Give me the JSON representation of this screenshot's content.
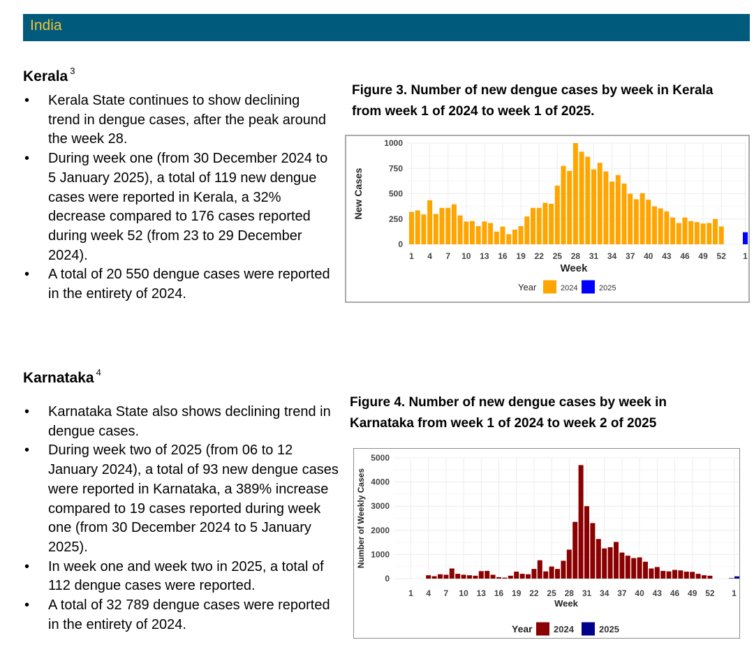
{
  "header": {
    "country": "India"
  },
  "colors": {
    "banner": "#005a7c",
    "banner_text": "#f5c338"
  },
  "kerala": {
    "title": "Kerala",
    "ref": "3",
    "bullets": [
      "Kerala State continues to show declining trend in dengue cases, after the peak around the week 28.",
      "During week one (from 30 December 2024 to 5 January 2025), a total of 119 new dengue cases were reported in Kerala, a 32% decrease compared to 176 cases reported during week 52 (from 23 to 29 December 2024).",
      "A total of 20 550 dengue cases were reported in the entirety of 2024."
    ],
    "figure_caption_line1": "Figure 3. Number of new dengue cases by week in Kerala",
    "figure_caption_line2": "from week 1 of 2024 to week 1 of 2025."
  },
  "karnataka": {
    "title": "Karnataka",
    "ref": "4",
    "bullets": [
      "Karnataka State also shows declining trend in dengue cases.",
      "During week two of 2025 (from 06 to 12 January 2024), a total of 93 new dengue cases were reported in Karnataka, a 389% increase compared to 19 cases reported during week one (from 30 December 2024 to 5 January 2025).",
      "In week one and week two in 2025, a total of 112 dengue cases were reported.",
      "A total of 32 789 dengue cases were reported in the entirety of 2024."
    ],
    "figure_caption_line1": "Figure 4. Number of new dengue cases by week in",
    "figure_caption_line2": "Karnataka from week 1 of 2024 to week 2 of 2025"
  },
  "chart_data": [
    {
      "type": "bar",
      "xlabel": "Week",
      "ylabel": "New Cases",
      "ylim": [
        0,
        1000
      ],
      "yticks": [
        0,
        250,
        500,
        750,
        1000
      ],
      "xtick_labels_2024": [
        "1",
        "4",
        "7",
        "10",
        "13",
        "16",
        "19",
        "22",
        "25",
        "28",
        "31",
        "34",
        "37",
        "40",
        "43",
        "46",
        "49",
        "52"
      ],
      "xtick_labels_2025": [
        "1"
      ],
      "legend_title": "Year",
      "legend_position": "bottom",
      "grid": true,
      "series": [
        {
          "name": "2024",
          "color": "#ffa500",
          "weeks": [
            1,
            2,
            3,
            4,
            5,
            6,
            7,
            8,
            9,
            10,
            11,
            12,
            13,
            14,
            15,
            16,
            17,
            18,
            19,
            20,
            21,
            22,
            23,
            24,
            25,
            26,
            27,
            28,
            29,
            30,
            31,
            32,
            33,
            34,
            35,
            36,
            37,
            38,
            39,
            40,
            41,
            42,
            43,
            44,
            45,
            46,
            47,
            48,
            49,
            50,
            51,
            52
          ],
          "values": [
            320,
            335,
            295,
            435,
            300,
            360,
            360,
            395,
            285,
            225,
            230,
            180,
            225,
            210,
            125,
            175,
            100,
            145,
            180,
            275,
            360,
            360,
            410,
            400,
            580,
            775,
            725,
            1000,
            915,
            865,
            740,
            805,
            720,
            620,
            685,
            600,
            500,
            445,
            505,
            440,
            375,
            355,
            325,
            265,
            210,
            265,
            230,
            220,
            205,
            210,
            250,
            176
          ]
        },
        {
          "name": "2025",
          "color": "#0000ff",
          "weeks": [
            1
          ],
          "values": [
            119
          ]
        }
      ]
    },
    {
      "type": "bar",
      "xlabel": "Week",
      "ylabel": "Number of Weekly Cases",
      "ylim": [
        0,
        5000
      ],
      "yticks": [
        0,
        1000,
        2000,
        3000,
        4000,
        5000
      ],
      "xtick_labels_2024": [
        "1",
        "4",
        "7",
        "10",
        "13",
        "16",
        "19",
        "22",
        "25",
        "28",
        "31",
        "34",
        "37",
        "40",
        "43",
        "46",
        "49",
        "52"
      ],
      "xtick_labels_2025": [
        "1"
      ],
      "legend_title": "Year",
      "legend_position": "bottom",
      "grid": true,
      "series": [
        {
          "name": "2024",
          "color": "#8b0000",
          "weeks": [
            1,
            2,
            3,
            4,
            5,
            6,
            7,
            8,
            9,
            10,
            11,
            12,
            13,
            14,
            15,
            16,
            17,
            18,
            19,
            20,
            21,
            22,
            23,
            24,
            25,
            26,
            27,
            28,
            29,
            30,
            31,
            32,
            33,
            34,
            35,
            36,
            37,
            38,
            39,
            40,
            41,
            42,
            43,
            44,
            45,
            46,
            47,
            48,
            49,
            50,
            51,
            52
          ],
          "values": [
            0,
            0,
            0,
            140,
            100,
            180,
            160,
            420,
            200,
            160,
            140,
            120,
            310,
            320,
            160,
            60,
            40,
            120,
            290,
            200,
            180,
            400,
            760,
            300,
            500,
            400,
            740,
            1200,
            2350,
            4700,
            3000,
            2300,
            1640,
            1250,
            1300,
            1520,
            1080,
            950,
            850,
            880,
            700,
            420,
            480,
            320,
            300,
            360,
            340,
            290,
            280,
            200,
            140,
            120
          ]
        },
        {
          "name": "2025",
          "color": "#00008b",
          "weeks": [
            1,
            2
          ],
          "values": [
            19,
            93
          ]
        }
      ]
    }
  ]
}
